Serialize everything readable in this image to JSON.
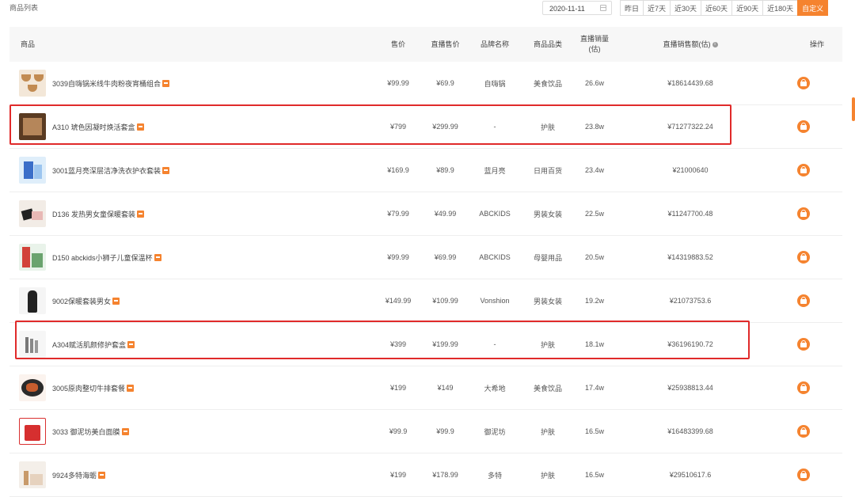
{
  "page": {
    "title": "商品列表"
  },
  "date_picker": {
    "value": "2020-11-11",
    "icon": "calendar-icon"
  },
  "date_ranges": [
    {
      "label": "昨日",
      "active": false
    },
    {
      "label": "近7天",
      "active": false
    },
    {
      "label": "近30天",
      "active": false
    },
    {
      "label": "近60天",
      "active": false
    },
    {
      "label": "近90天",
      "active": false
    },
    {
      "label": "近180天",
      "active": false
    },
    {
      "label": "自定义",
      "active": true
    }
  ],
  "table": {
    "headers": {
      "product": "商品",
      "price": "售价",
      "live_price": "直播售价",
      "brand": "品牌名称",
      "category": "商品品类",
      "live_sales": "直播销量\n(估)",
      "live_revenue": "直播销售额(估)",
      "action": "操作"
    },
    "rows": [
      {
        "name": "3039自嗨锅米线牛肉粉夜宵桶组合",
        "price": "¥99.99",
        "live_price": "¥69.9",
        "brand": "自嗨锅",
        "category": "美食饮品",
        "sales": "26.6w",
        "revenue": "¥18614439.68",
        "highlighted": false
      },
      {
        "name": "A310 琥色因凝时焕活套盒",
        "price": "¥799",
        "live_price": "¥299.99",
        "brand": "-",
        "category": "护肤",
        "sales": "23.8w",
        "revenue": "¥71277322.24",
        "highlighted": true
      },
      {
        "name": "3001蓝月亮深层洁净洗衣护衣套装",
        "price": "¥169.9",
        "live_price": "¥89.9",
        "brand": "蓝月亮",
        "category": "日用百货",
        "sales": "23.4w",
        "revenue": "¥21000640",
        "highlighted": false
      },
      {
        "name": "D136 发热男女童保暖套装",
        "price": "¥79.99",
        "live_price": "¥49.99",
        "brand": "ABCKIDS",
        "category": "男装女装",
        "sales": "22.5w",
        "revenue": "¥11247700.48",
        "highlighted": false
      },
      {
        "name": "D150 abckids小狮子儿童保温杯",
        "price": "¥99.99",
        "live_price": "¥69.99",
        "brand": "ABCKIDS",
        "category": "母婴用品",
        "sales": "20.5w",
        "revenue": "¥14319883.52",
        "highlighted": false
      },
      {
        "name": "9002保暖套装男女",
        "price": "¥149.99",
        "live_price": "¥109.99",
        "brand": "Vonshion",
        "category": "男装女装",
        "sales": "19.2w",
        "revenue": "¥21073753.6",
        "highlighted": false
      },
      {
        "name": "A304赋活肌颜修护套盒",
        "price": "¥399",
        "live_price": "¥199.99",
        "brand": "-",
        "category": "护肤",
        "sales": "18.1w",
        "revenue": "¥36196190.72",
        "highlighted": true
      },
      {
        "name": "3005原肉整切牛排套餐",
        "price": "¥199",
        "live_price": "¥149",
        "brand": "大希地",
        "category": "美食饮品",
        "sales": "17.4w",
        "revenue": "¥25938813.44",
        "highlighted": false
      },
      {
        "name": "3033 御泥坊美白面膜",
        "price": "¥99.9",
        "live_price": "¥99.9",
        "brand": "御泥坊",
        "category": "护肤",
        "sales": "16.5w",
        "revenue": "¥16483399.68",
        "highlighted": false
      },
      {
        "name": "9924多特海蛎",
        "price": "¥199",
        "live_price": "¥178.99",
        "brand": "多特",
        "category": "护肤",
        "sales": "16.5w",
        "revenue": "¥29510617.6",
        "highlighted": false
      }
    ]
  },
  "icons": {
    "badge": "tmall-badge-icon",
    "action": "shop-bag-icon",
    "info": "info-icon"
  },
  "colors": {
    "accent": "#f5832f",
    "highlight": "#e02a2a"
  }
}
